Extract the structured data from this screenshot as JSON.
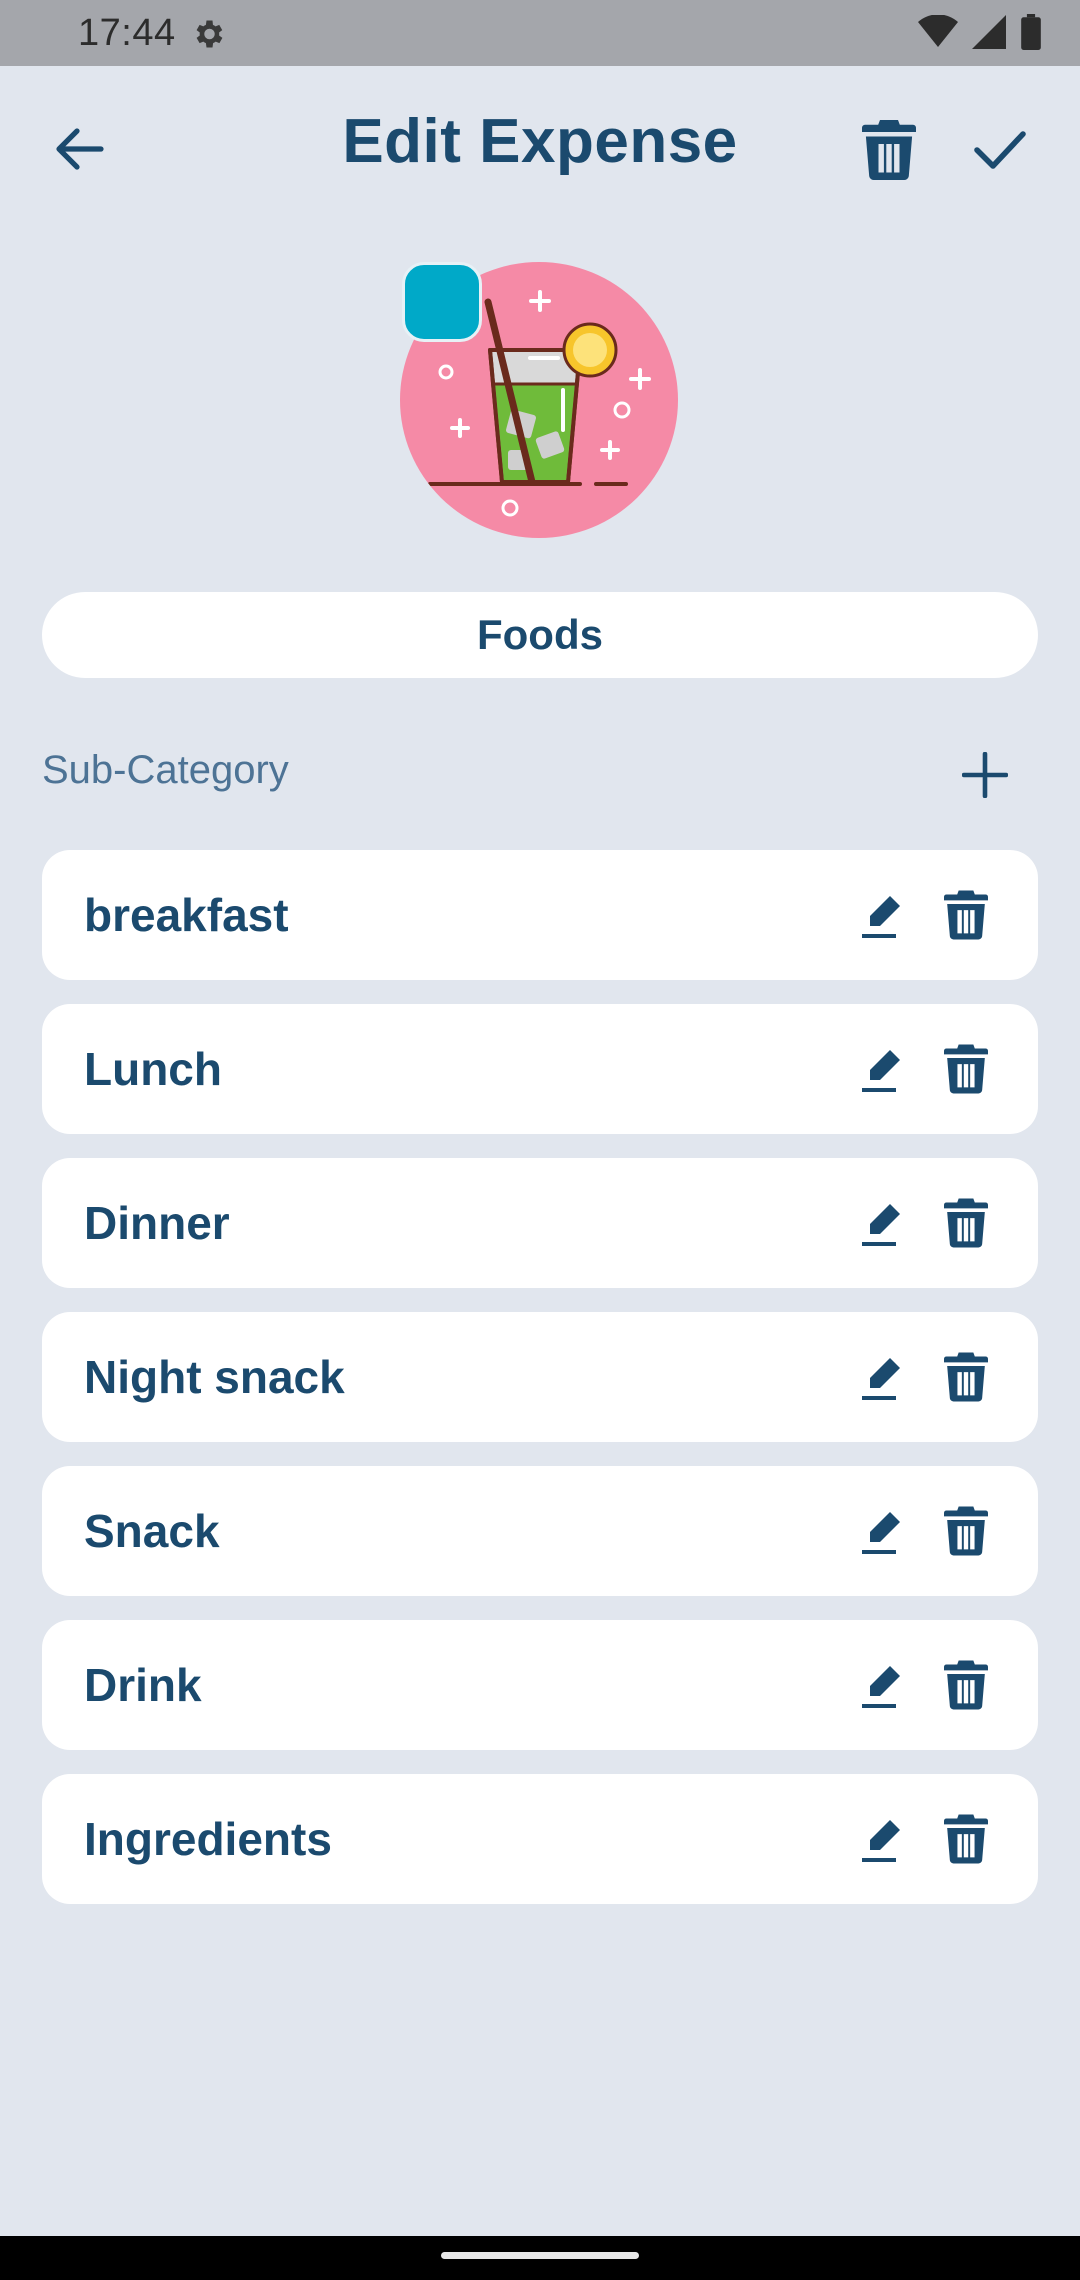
{
  "status_bar": {
    "time": "17:44",
    "icons": [
      "settings-gear-icon",
      "wifi-icon",
      "signal-icon",
      "battery-icon"
    ]
  },
  "app_bar": {
    "title": "Edit Expense",
    "back_icon": "arrow-left-icon",
    "delete_icon": "trash-icon",
    "save_icon": "check-icon"
  },
  "category": {
    "icon": "drink-glass-icon",
    "color": "#00a9c8",
    "icon_background": "#f58aa6",
    "name": "Foods"
  },
  "sub_category": {
    "label": "Sub-Category",
    "add_icon": "plus-icon",
    "items": [
      {
        "label": "breakfast"
      },
      {
        "label": "Lunch"
      },
      {
        "label": "Dinner"
      },
      {
        "label": "Night snack"
      },
      {
        "label": "Snack"
      },
      {
        "label": "Drink"
      },
      {
        "label": "Ingredients"
      }
    ]
  },
  "colors": {
    "background": "#e1e6ee",
    "primary_text": "#1b4a6e",
    "secondary_text": "#4d7395"
  }
}
